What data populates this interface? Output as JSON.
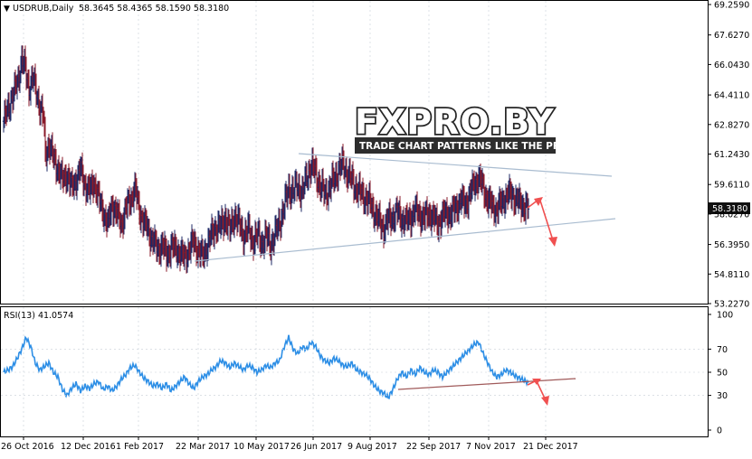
{
  "header": {
    "triangle": "▼",
    "symbol": "USDRUB,Daily",
    "ohlc": "58.3645 58.4365 58.1590 58.3180"
  },
  "rsi_header": "RSI(13) 41.0574",
  "watermark": {
    "brand": "FXPRO.BY",
    "tagline": "TRADE CHART PATTERNS LIKE THE PROS"
  },
  "price_tag": "58.3180",
  "colors": {
    "up_bar": "#1c2866",
    "down_bar": "#8a1a2a",
    "rsi_line": "#2e8fe6",
    "trend_line": "#a9bcd0",
    "rsi_trend": "#a05a5a",
    "arrow": "#f05050",
    "grid": "#c8d0d8",
    "frame": "#000000"
  },
  "chart_data": [
    {
      "type": "ohlc",
      "symbol": "USDRUB",
      "timeframe": "Daily",
      "x_tick_labels": [
        "26 Oct 2016",
        "12 Dec 2016",
        "1 Feb 2017",
        "22 Mar 2017",
        "10 May 2017",
        "26 Jun 2017",
        "9 Aug 2017",
        "22 Sep 2017",
        "7 Nov 2017",
        "21 Dec 2017"
      ],
      "y_tick_labels": [
        "69.2590",
        "67.6270",
        "66.0430",
        "64.4110",
        "62.8270",
        "61.2430",
        "59.6110",
        "58.0270",
        "56.3950",
        "54.8110",
        "53.2270"
      ],
      "ylim": [
        53.227,
        69.259
      ],
      "last": {
        "open": 58.3645,
        "high": 58.4365,
        "low": 58.159,
        "close": 58.318
      },
      "approx_closes": [
        [
          0,
          63.0
        ],
        [
          4,
          63.5
        ],
        [
          8,
          64.2
        ],
        [
          12,
          64.6
        ],
        [
          16,
          65.2
        ],
        [
          20,
          66.4
        ],
        [
          24,
          65.7
        ],
        [
          28,
          64.8
        ],
        [
          32,
          65.3
        ],
        [
          36,
          64.6
        ],
        [
          40,
          63.8
        ],
        [
          44,
          63.2
        ],
        [
          46,
          61.2
        ],
        [
          50,
          61.8
        ],
        [
          55,
          61.0
        ],
        [
          60,
          60.5
        ],
        [
          65,
          59.8
        ],
        [
          70,
          60.2
        ],
        [
          75,
          59.4
        ],
        [
          80,
          59.9
        ],
        [
          85,
          60.4
        ],
        [
          90,
          59.6
        ],
        [
          95,
          59.2
        ],
        [
          100,
          59.8
        ],
        [
          105,
          58.8
        ],
        [
          110,
          58.2
        ],
        [
          115,
          57.4
        ],
        [
          120,
          58.6
        ],
        [
          125,
          58.0
        ],
        [
          130,
          57.5
        ],
        [
          135,
          58.3
        ],
        [
          140,
          58.8
        ],
        [
          145,
          59.4
        ],
        [
          150,
          58.2
        ],
        [
          155,
          57.6
        ],
        [
          160,
          57.1
        ],
        [
          165,
          56.6
        ],
        [
          170,
          56.1
        ],
        [
          175,
          56.4
        ],
        [
          180,
          55.8
        ],
        [
          185,
          56.3
        ],
        [
          190,
          56.1
        ],
        [
          195,
          56.0
        ],
        [
          200,
          55.6
        ],
        [
          205,
          56.2
        ],
        [
          210,
          56.5
        ],
        [
          215,
          56.1
        ],
        [
          220,
          55.7
        ],
        [
          225,
          56.4
        ],
        [
          230,
          56.9
        ],
        [
          235,
          57.4
        ],
        [
          240,
          57.3
        ],
        [
          245,
          57.9
        ],
        [
          250,
          57.1
        ],
        [
          255,
          58.0
        ],
        [
          260,
          57.5
        ],
        [
          265,
          56.9
        ],
        [
          270,
          57.2
        ],
        [
          275,
          56.6
        ],
        [
          280,
          56.9
        ],
        [
          285,
          56.5
        ],
        [
          290,
          56.8
        ],
        [
          295,
          56.4
        ],
        [
          300,
          56.9
        ],
        [
          305,
          57.6
        ],
        [
          310,
          58.4
        ],
        [
          315,
          59.4
        ],
        [
          320,
          59.2
        ],
        [
          325,
          59.6
        ],
        [
          330,
          59.1
        ],
        [
          335,
          60.1
        ],
        [
          340,
          60.6
        ],
        [
          345,
          60.2
        ],
        [
          350,
          59.5
        ],
        [
          355,
          59.1
        ],
        [
          360,
          59.4
        ],
        [
          365,
          59.9
        ],
        [
          370,
          60.4
        ],
        [
          375,
          60.7
        ],
        [
          380,
          60.2
        ],
        [
          385,
          59.8
        ],
        [
          390,
          59.4
        ],
        [
          395,
          59.1
        ],
        [
          400,
          58.9
        ],
        [
          405,
          58.6
        ],
        [
          410,
          58.1
        ],
        [
          415,
          57.6
        ],
        [
          420,
          57.3
        ],
        [
          425,
          57.7
        ],
        [
          430,
          57.9
        ],
        [
          435,
          58.1
        ],
        [
          440,
          57.8
        ],
        [
          445,
          57.6
        ],
        [
          450,
          57.9
        ],
        [
          455,
          58.2
        ],
        [
          460,
          58.0
        ],
        [
          465,
          57.8
        ],
        [
          470,
          58.1
        ],
        [
          475,
          57.8
        ],
        [
          480,
          57.5
        ],
        [
          485,
          57.9
        ],
        [
          490,
          58.1
        ],
        [
          495,
          58.0
        ],
        [
          500,
          58.4
        ],
        [
          505,
          58.8
        ],
        [
          510,
          58.5
        ],
        [
          515,
          59.1
        ],
        [
          520,
          59.6
        ],
        [
          525,
          60.0
        ],
        [
          530,
          59.4
        ],
        [
          535,
          58.8
        ],
        [
          540,
          58.4
        ],
        [
          545,
          58.3
        ],
        [
          550,
          58.6
        ],
        [
          555,
          59.0
        ],
        [
          560,
          59.1
        ],
        [
          565,
          58.9
        ],
        [
          570,
          58.6
        ],
        [
          575,
          58.5
        ],
        [
          580,
          58.3
        ]
      ],
      "annotations": [
        "symmetrical triangle",
        "down arrow"
      ]
    },
    {
      "type": "line",
      "indicator": "RSI(13)",
      "value": 41.0574,
      "y_tick_labels": [
        "100",
        "70",
        "50",
        "30",
        "0"
      ],
      "levels": [
        70,
        50,
        30
      ],
      "ylim": [
        0,
        100
      ],
      "series": [
        {
          "values": [
            [
              0,
              50
            ],
            [
              5,
              52
            ],
            [
              10,
              55
            ],
            [
              15,
              62
            ],
            [
              20,
              70
            ],
            [
              25,
              80
            ],
            [
              30,
              72
            ],
            [
              35,
              58
            ],
            [
              40,
              52
            ],
            [
              45,
              55
            ],
            [
              50,
              58
            ],
            [
              55,
              50
            ],
            [
              60,
              46
            ],
            [
              65,
              35
            ],
            [
              70,
              30
            ],
            [
              75,
              36
            ],
            [
              80,
              40
            ],
            [
              85,
              34
            ],
            [
              90,
              38
            ],
            [
              95,
              36
            ],
            [
              100,
              40
            ],
            [
              105,
              42
            ],
            [
              110,
              35
            ],
            [
              115,
              38
            ],
            [
              120,
              34
            ],
            [
              125,
              38
            ],
            [
              130,
              44
            ],
            [
              135,
              48
            ],
            [
              140,
              54
            ],
            [
              145,
              56
            ],
            [
              150,
              50
            ],
            [
              155,
              45
            ],
            [
              160,
              42
            ],
            [
              165,
              38
            ],
            [
              170,
              40
            ],
            [
              175,
              36
            ],
            [
              180,
              40
            ],
            [
              185,
              34
            ],
            [
              190,
              38
            ],
            [
              195,
              42
            ],
            [
              200,
              46
            ],
            [
              205,
              40
            ],
            [
              210,
              36
            ],
            [
              215,
              42
            ],
            [
              220,
              46
            ],
            [
              225,
              48
            ],
            [
              230,
              52
            ],
            [
              235,
              55
            ],
            [
              240,
              60
            ],
            [
              245,
              58
            ],
            [
              250,
              54
            ],
            [
              255,
              58
            ],
            [
              260,
              55
            ],
            [
              265,
              52
            ],
            [
              270,
              56
            ],
            [
              275,
              54
            ],
            [
              280,
              50
            ],
            [
              285,
              52
            ],
            [
              290,
              56
            ],
            [
              295,
              54
            ],
            [
              300,
              58
            ],
            [
              305,
              60
            ],
            [
              310,
              72
            ],
            [
              315,
              80
            ],
            [
              320,
              70
            ],
            [
              325,
              66
            ],
            [
              330,
              72
            ],
            [
              335,
              70
            ],
            [
              340,
              76
            ],
            [
              345,
              72
            ],
            [
              350,
              64
            ],
            [
              355,
              60
            ],
            [
              360,
              58
            ],
            [
              365,
              62
            ],
            [
              370,
              60
            ],
            [
              375,
              56
            ],
            [
              380,
              55
            ],
            [
              385,
              58
            ],
            [
              390,
              52
            ],
            [
              395,
              50
            ],
            [
              400,
              48
            ],
            [
              405,
              44
            ],
            [
              410,
              38
            ],
            [
              415,
              34
            ],
            [
              420,
              32
            ],
            [
              425,
              28
            ],
            [
              430,
              35
            ],
            [
              435,
              44
            ],
            [
              440,
              50
            ],
            [
              445,
              46
            ],
            [
              450,
              52
            ],
            [
              455,
              48
            ],
            [
              460,
              54
            ],
            [
              465,
              50
            ],
            [
              470,
              48
            ],
            [
              475,
              52
            ],
            [
              480,
              50
            ],
            [
              485,
              46
            ],
            [
              490,
              50
            ],
            [
              495,
              54
            ],
            [
              500,
              58
            ],
            [
              505,
              62
            ],
            [
              510,
              66
            ],
            [
              515,
              70
            ],
            [
              520,
              74
            ],
            [
              525,
              76
            ],
            [
              530,
              66
            ],
            [
              535,
              58
            ],
            [
              540,
              50
            ],
            [
              545,
              46
            ],
            [
              550,
              48
            ],
            [
              555,
              52
            ],
            [
              560,
              50
            ],
            [
              565,
              47
            ],
            [
              570,
              45
            ],
            [
              575,
              43
            ],
            [
              580,
              41
            ]
          ]
        }
      ]
    }
  ]
}
